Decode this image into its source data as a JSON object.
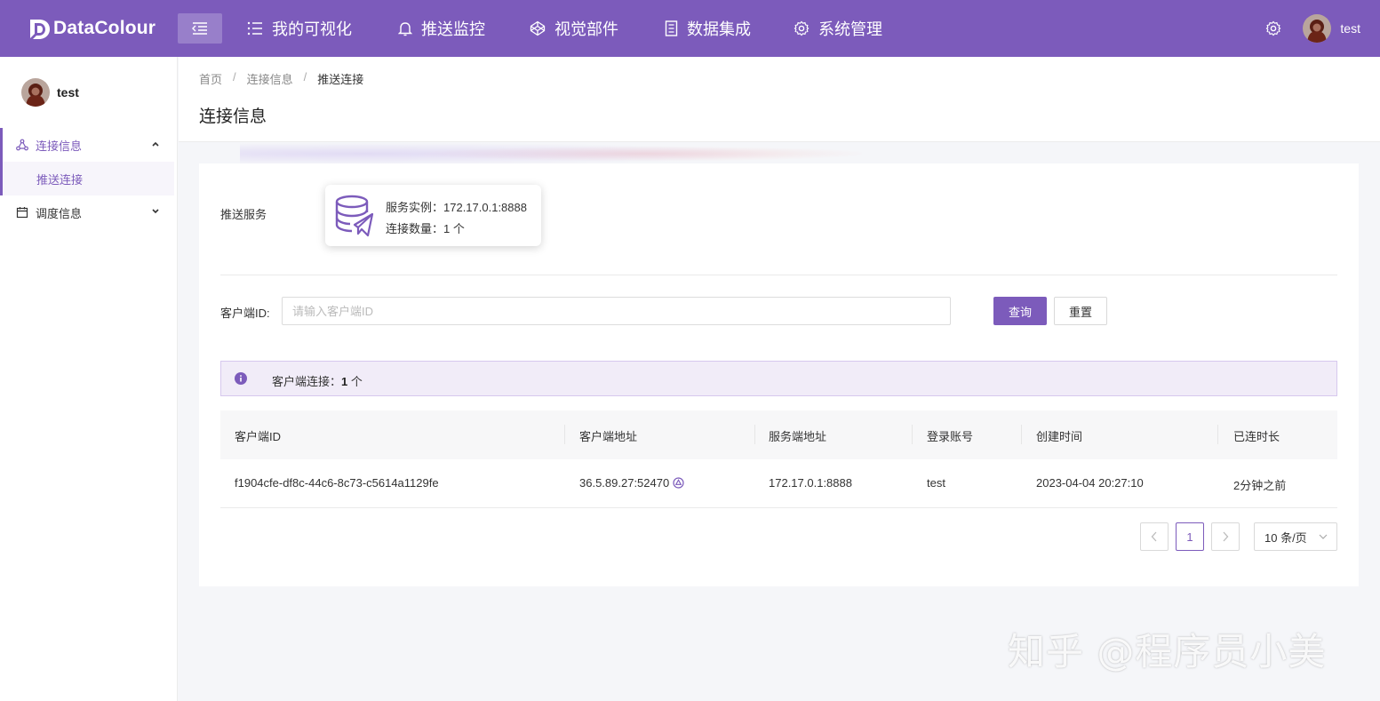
{
  "app": {
    "brand": "DataColour",
    "colors": {
      "primary": "#7c5bbb",
      "alert_bg": "#f1ecf8"
    }
  },
  "topnav": {
    "items": [
      {
        "label": "我的可视化",
        "icon": "list-icon"
      },
      {
        "label": "推送监控",
        "icon": "bell-icon"
      },
      {
        "label": "视觉部件",
        "icon": "codepen-icon"
      },
      {
        "label": "数据集成",
        "icon": "document-icon"
      },
      {
        "label": "系统管理",
        "icon": "gear-icon"
      }
    ],
    "username": "test"
  },
  "sidebar": {
    "username": "test",
    "groups": [
      {
        "label": "连接信息",
        "icon": "share-nodes-icon",
        "expanded": true,
        "children": [
          "推送连接"
        ]
      },
      {
        "label": "调度信息",
        "icon": "calendar-icon",
        "expanded": false
      }
    ]
  },
  "breadcrumb": [
    "首页",
    "连接信息",
    "推送连接"
  ],
  "page_title": "连接信息",
  "service": {
    "label": "推送服务",
    "instance_line": "服务实例：172.17.0.1:8888",
    "count_line": "连接数量：1 个"
  },
  "query": {
    "label": "客户端ID:",
    "placeholder": "请输入客户端ID",
    "value": "",
    "query_button": "查询",
    "reset_button": "重置"
  },
  "alert": {
    "prefix": "客户端连接：",
    "count": "1",
    "suffix": " 个"
  },
  "table": {
    "columns": [
      "客户端ID",
      "客户端地址",
      "服务端地址",
      "登录账号",
      "创建时间",
      "已连时长"
    ],
    "rows": [
      [
        "f1904cfe-df8c-44c6-8c73-c5614a1129fe",
        "36.5.89.27:52470",
        "172.17.0.1:8888",
        "test",
        "2023-04-04 20:27:10",
        "2分钟之前"
      ]
    ]
  },
  "pagination": {
    "current_page": "1",
    "page_size": "10 条/页"
  },
  "watermark": "知乎 @程序员小美"
}
